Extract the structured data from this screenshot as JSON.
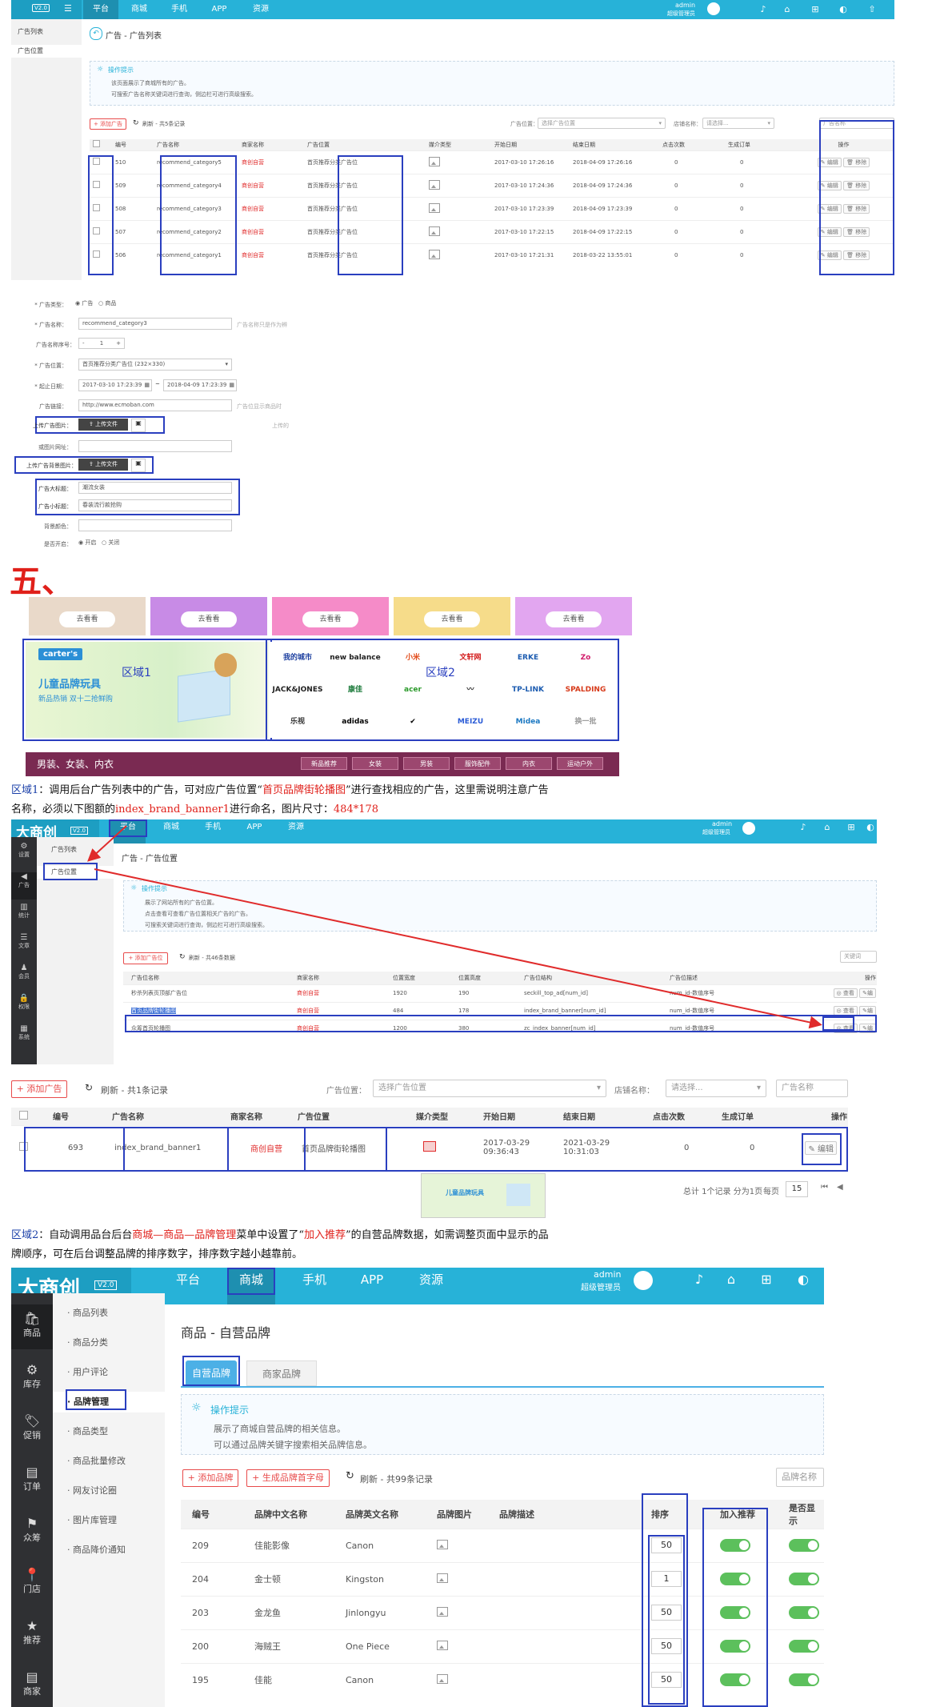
{
  "s1": {
    "logo_v": "V2.0",
    "nav": [
      "平台",
      "商城",
      "手机",
      "APP",
      "资源"
    ],
    "admin_name": "admin",
    "admin_role": "超级管理员",
    "side": [
      "广告列表",
      "广告位置"
    ],
    "page_title": "广告 - 广告列表",
    "tip_title": "操作提示",
    "tips": [
      "该页面展示了商城所有的广告。",
      "可搜索广告名称关键词进行查询，侧边栏可进行高级搜索。"
    ],
    "add_btn": "+ 添加广告",
    "refresh": "刷新 - 共5条记录",
    "pos_label": "广告位置：",
    "pos_select": "选择广告位置",
    "shop_label": "店铺名称：",
    "shop_select": "请选择...",
    "search_ph": "广告名称",
    "headers": [
      "编号",
      "广告名称",
      "商家名称",
      "广告位置",
      "媒介类型",
      "开始日期",
      "结束日期",
      "点击次数",
      "生成订单",
      "操作"
    ],
    "rows": [
      {
        "id": "510",
        "name": "recommend_category5",
        "shop": "商创自营",
        "pos": "首页推荐分类广告位",
        "start": "2017-03-10 17:26:16",
        "end": "2018-04-09 17:26:16",
        "clicks": "0",
        "orders": "0"
      },
      {
        "id": "509",
        "name": "recommend_category4",
        "shop": "商创自营",
        "pos": "首页推荐分类广告位",
        "start": "2017-03-10 17:24:36",
        "end": "2018-04-09 17:24:36",
        "clicks": "0",
        "orders": "0"
      },
      {
        "id": "508",
        "name": "recommend_category3",
        "shop": "商创自营",
        "pos": "首页推荐分类广告位",
        "start": "2017-03-10 17:23:39",
        "end": "2018-04-09 17:23:39",
        "clicks": "0",
        "orders": "0"
      },
      {
        "id": "507",
        "name": "recommend_category2",
        "shop": "商创自营",
        "pos": "首页推荐分类广告位",
        "start": "2017-03-10 17:22:15",
        "end": "2018-04-09 17:22:15",
        "clicks": "0",
        "orders": "0"
      },
      {
        "id": "506",
        "name": "recommend_category1",
        "shop": "商创自营",
        "pos": "首页推荐分类广告位",
        "start": "2017-03-10 17:21:31",
        "end": "2018-03-22 13:55:01",
        "clicks": "0",
        "orders": "0"
      }
    ],
    "op_edit": "编辑",
    "op_remove": "移除"
  },
  "form": {
    "type_label": "* 广告类型：",
    "type_opt1": "广告",
    "type_opt2": "商品",
    "name_label": "* 广告名称：",
    "name_value": "recommend_category3",
    "name_hint": "广告名称只是作为辨",
    "seq_label": "广告名称序号：",
    "seq_minus": "-",
    "seq_value": "1",
    "seq_plus": "+",
    "pos_label": "* 广告位置：",
    "pos_value": "首页推荐分类广告位 (232×330)",
    "date_label": "* 起止日期：",
    "date_start": "2017-03-10 17:23:39",
    "date_sep": "~",
    "date_end": "2018-04-09 17:23:39",
    "link_label": "广告链接：",
    "link_value": "http://www.ecmoban.com",
    "link_hint": "广告位显示商品时",
    "upload_label": "上传广告图片：",
    "upload_btn": "上传文件",
    "upload_hint": "上传的",
    "thumb_label": "或图片网址：",
    "bg_label": "上传广告背景图片：",
    "title_label": "广告大标题：",
    "title_value": "潮流女装",
    "subtitle_label": "广告小标题：",
    "subtitle_value": "春装流行款抢购",
    "color_label": "背景颜色：",
    "open_label": "是否开启：",
    "open_opt1": "开启",
    "open_opt2": "关闭"
  },
  "section_heading": "五、",
  "banner": {
    "see_btn": "去看看",
    "card_colors": [
      "#e9d9c9",
      "#c88be6",
      "#f58bc8",
      "#f6dc8a",
      "#e2a6f0"
    ],
    "promo_brand": "carter's",
    "promo_title": "儿童品牌玩具",
    "promo_sub": "新品热销 双十二抢鲜购",
    "region1": "区域1",
    "region2": "区域2",
    "brands": [
      "我的城市",
      "new balance",
      "小米",
      "文轩网",
      "ERKE",
      "Zo",
      "JACK&JONES",
      "康佳",
      "acer",
      "",
      "TP-LINK",
      "SPALDING",
      "乐视",
      "adidas",
      "",
      "MEIZU",
      "Midea",
      "换一批"
    ],
    "cats": [
      "男装、女装、内衣",
      "新品推荐",
      "女装",
      "男装",
      "服饰配件",
      "内衣",
      "运动户外"
    ]
  },
  "para1": {
    "t1": "区域1",
    "t2": "：调用后台广告列表中的广告，可对应广告位置“",
    "t3": "首页品牌街轮播图",
    "t4": "”进行查找相应的广告，这里需说明注意广告",
    "t5": "名称，必须以下图额的",
    "t6": "index_brand_banner1",
    "t7": "进行命名，图片尺寸：",
    "t8": "484*178"
  },
  "s2": {
    "logo": "大商创",
    "logo_v": "V2.0",
    "nav": [
      "平台",
      "商城",
      "手机",
      "APP",
      "资源"
    ],
    "admin_name": "admin",
    "admin_role": "超级管理员",
    "dark_side": [
      "设置",
      "广告",
      "统计",
      "文章",
      "会员",
      "权限",
      "系统"
    ],
    "side": [
      "广告列表",
      "广告位置"
    ],
    "page_title": "广告 - 广告位置",
    "tip_title": "操作提示",
    "tips": [
      "展示了网站所有的广告位置。",
      "点击查看可查看广告位置相关广告的广告。",
      "可搜索关键词进行查询，侧边栏可进行高级搜索。"
    ],
    "add_btn": "+ 添加广告位",
    "refresh": "刷新 - 共46条数据",
    "search_ph": "关键词",
    "headers": [
      "广告位名称",
      "商家名称",
      "位置宽度",
      "位置高度",
      "广告位结构",
      "广告位描述",
      "操作"
    ],
    "rows": [
      {
        "name": "秒杀列表页顶部广告位",
        "shop": "商创自营",
        "w": "1920",
        "h": "190",
        "code": "seckill_top_ad[num_id]",
        "desc": "num_id-数值序号"
      },
      {
        "name": "首页品牌街轮播图",
        "shop": "商创自营",
        "w": "484",
        "h": "178",
        "code": "index_brand_banner[num_id]",
        "desc": "num_id-数值序号"
      },
      {
        "name": "众筹首页轮播图",
        "shop": "商创自营",
        "w": "1200",
        "h": "380",
        "code": "zc_index_banner[num_id]",
        "desc": "num_id-数值序号"
      }
    ],
    "op_view": "查看",
    "op_edit": "编"
  },
  "s3": {
    "add_btn": "+ 添加广告",
    "refresh": "刷新 - 共1条记录",
    "pos_label": "广告位置：",
    "pos_select": "选择广告位置",
    "shop_label": "店铺名称：",
    "shop_select": "请选择...",
    "search_ph": "广告名称",
    "headers": [
      "编号",
      "广告名称",
      "商家名称",
      "广告位置",
      "媒介类型",
      "开始日期",
      "结束日期",
      "点击次数",
      "生成订单",
      "操作"
    ],
    "row": {
      "id": "693",
      "name": "index_brand_banner1",
      "shop": "商创自营",
      "pos": "首页品牌街轮播图",
      "start": "2017-03-29",
      "start_t": "09:36:43",
      "end": "2021-03-29",
      "end_t": "10:31:03",
      "clicks": "0",
      "orders": "0"
    },
    "op_edit": "编辑",
    "pager": "总计 1个记录 分为1页",
    "per_page_label": "每页",
    "per_page": "15",
    "thumb_text": "儿童品牌玩具"
  },
  "para2": {
    "t1": "区域2",
    "t2": "：自动调用品台后台",
    "t3": "商城—商品—品牌管理",
    "t4": "菜单中设置了“",
    "t5": "加入推荐",
    "t6": "”的自营品牌数据，如需调整页面中显示的品",
    "t7": "牌顺序，可在后台调整品牌的排序数字，排序数字越小越靠前。"
  },
  "s4": {
    "logo": "大商创",
    "logo_v": "V2.0",
    "nav": [
      "平台",
      "商城",
      "手机",
      "APP",
      "资源"
    ],
    "admin_name": "admin",
    "admin_role": "超级管理员",
    "dark_side": [
      "商品",
      "库存",
      "促销",
      "订单",
      "众筹",
      "门店",
      "推荐",
      "商家"
    ],
    "side": [
      "商品列表",
      "商品分类",
      "用户评论",
      "品牌管理",
      "商品类型",
      "商品批量修改",
      "网友讨论圈",
      "图片库管理",
      "商品降价通知"
    ],
    "page_title": "商品 - 自营品牌",
    "tabs": [
      "自营品牌",
      "商家品牌"
    ],
    "tip_title": "操作提示",
    "tips": [
      "展示了商城自营品牌的相关信息。",
      "可以通过品牌关键字搜索相关品牌信息。"
    ],
    "add_btn": "+ 添加品牌",
    "gen_btn": "+ 生成品牌首字母",
    "refresh": "刷新 - 共99条记录",
    "search_ph": "品牌名称",
    "headers": [
      "编号",
      "品牌中文名称",
      "品牌英文名称",
      "品牌图片",
      "品牌描述",
      "排序",
      "加入推荐",
      "是否显示"
    ],
    "rows": [
      {
        "id": "209",
        "cn": "佳能影像",
        "en": "Canon",
        "sort": "50"
      },
      {
        "id": "204",
        "cn": "金士顿",
        "en": "Kingston",
        "sort": "1"
      },
      {
        "id": "203",
        "cn": "金龙鱼",
        "en": "Jinlongyu",
        "sort": "50"
      },
      {
        "id": "200",
        "cn": "海贼王",
        "en": "One Piece",
        "sort": "50"
      },
      {
        "id": "195",
        "cn": "佳能",
        "en": "Canon",
        "sort": "50"
      }
    ]
  }
}
